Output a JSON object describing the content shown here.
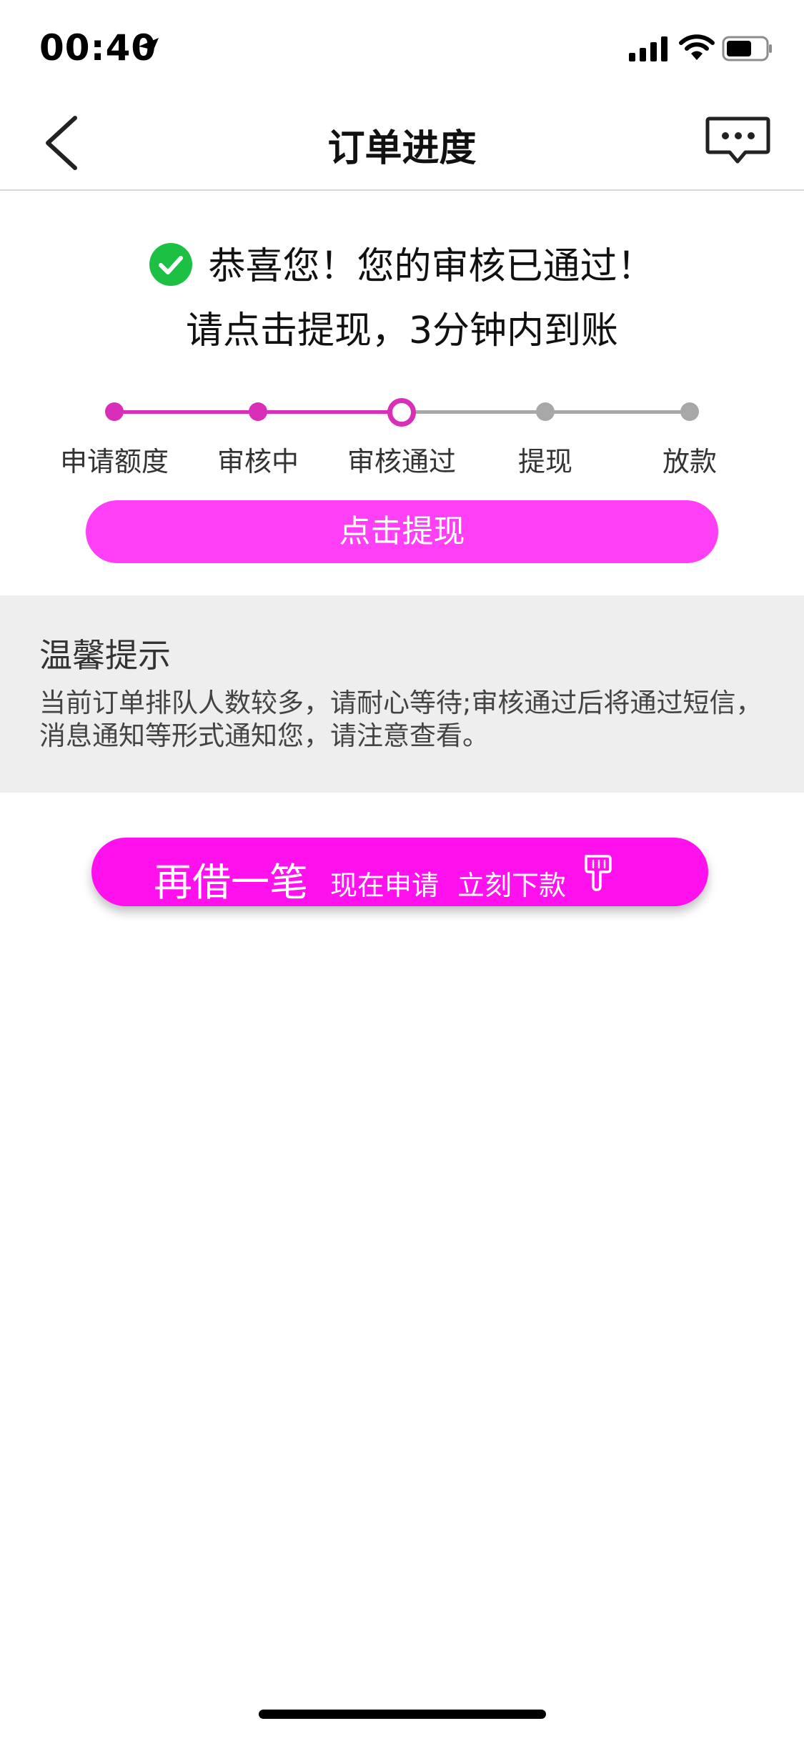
{
  "status_bar": {
    "time": "00:40"
  },
  "nav": {
    "title": "订单进度"
  },
  "success": {
    "message": "恭喜您！您的审核已通过！",
    "hint": "请点击提现，3分钟内到账"
  },
  "progress": {
    "steps": [
      {
        "label": "申请额度",
        "state": "done"
      },
      {
        "label": "审核中",
        "state": "done"
      },
      {
        "label": "审核通过",
        "state": "current"
      },
      {
        "label": "提现",
        "state": "todo"
      },
      {
        "label": "放款",
        "state": "todo"
      }
    ]
  },
  "withdraw_button": {
    "label": "点击提现"
  },
  "tips": {
    "title": "温馨提示",
    "body": "当前订单排队人数较多，请耐心等待;审核通过后将通过短信，消息通知等形式通知您，请注意查看。"
  },
  "borrow_button": {
    "main_label": "再借一笔",
    "sub_label_1": "现在申请",
    "sub_label_2": "立刻下款"
  },
  "colors": {
    "accent": "#d92fb8",
    "withdraw_button": "#ff3ff5",
    "borrow_button": "#ff11ee",
    "success_green": "#1cc043",
    "inactive": "#a8a8a8"
  },
  "icons": [
    "location-arrow-icon",
    "signal-icon",
    "wifi-icon",
    "battery-icon",
    "back-chevron-icon",
    "message-bubble-icon",
    "check-circle-icon",
    "pointing-hand-icon"
  ]
}
